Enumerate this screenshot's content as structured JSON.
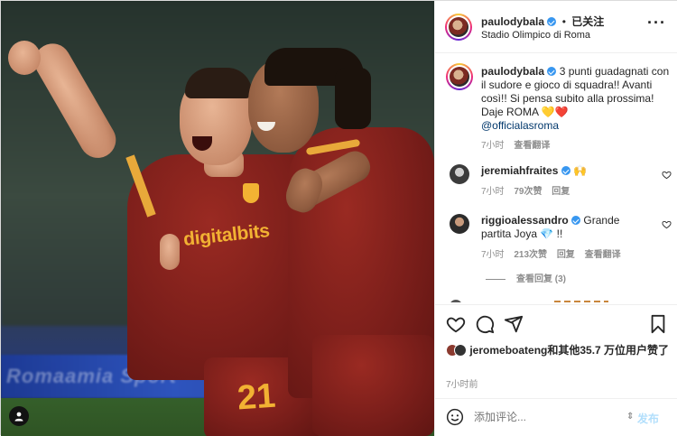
{
  "post": {
    "username": "paulodybala",
    "follow_status": "已关注",
    "dot": "•",
    "location": "Stadio Olimpico di Roma",
    "more_label": "···"
  },
  "photo": {
    "sponsor_text": "digitalbits",
    "shirt_number": "21",
    "board_text": "Romaamia Sport"
  },
  "caption": {
    "username": "paulodybala",
    "text": "3 punti guadagnati con il sudore e gioco di squadra!! Avanti così!! Si pensa subito alla prossima! Daje ROMA 💛❤️",
    "mention": "@officialasroma",
    "time": "7小时",
    "translate": "查看翻译"
  },
  "comments": [
    {
      "username": "jeremiahfraites",
      "text": "🙌",
      "time": "7小时",
      "likes": "79次赞",
      "reply": "回复"
    },
    {
      "username": "riggioalessandro",
      "text": "Grande partita Joya 💎 !!",
      "time": "7小时",
      "likes": "213次赞",
      "reply": "回复",
      "translate": "查看翻译"
    }
  ],
  "view_replies": "查看回复 (3)",
  "likes_line": {
    "username": "jeromeboateng",
    "rest": "和其他35.7 万位用户赞了"
  },
  "time_ago": "7小时前",
  "add_comment": {
    "placeholder": "添加评论...",
    "post_label": "发布"
  },
  "icons": [
    "heart-icon",
    "comment-icon",
    "share-icon",
    "bookmark-icon",
    "emoji-icon",
    "user-tag-icon",
    "more-icon",
    "verified-icon"
  ],
  "colors": {
    "verified": "#3897f0",
    "link": "#00376b",
    "muted": "#8e8e8e",
    "post_disabled": "#b2dffc",
    "roma_red": "#7a1e1a",
    "roma_gold": "#f2b233"
  }
}
